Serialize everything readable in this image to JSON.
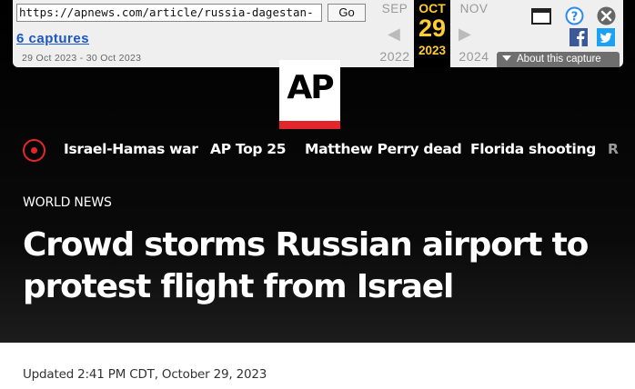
{
  "wayback": {
    "url": "https://apnews.com/article/russia-dagestan-",
    "go_label": "Go",
    "captures": "6 captures",
    "range": "29 Oct 2023 - 30 Oct 2023",
    "prev": {
      "month": "SEP",
      "year": "2022"
    },
    "current": {
      "month": "OCT",
      "day": "29",
      "year": "2023"
    },
    "next": {
      "month": "NOV",
      "year": "2024"
    },
    "about": "About this capture",
    "icons": [
      "window-icon",
      "help-icon",
      "close-icon",
      "facebook-icon",
      "twitter-icon"
    ]
  },
  "logo": {
    "text": "AP"
  },
  "nav": {
    "items": [
      "Israel-Hamas war",
      "AP Top 25",
      "Matthew Perry dead",
      "Florida shooting",
      "R"
    ]
  },
  "article": {
    "kicker": "WORLD NEWS",
    "headline": "Crowd storms Russian airport to protest flight from Israel",
    "updated": "Updated 2:41 PM CDT, October 29, 2023"
  },
  "colors": {
    "accent": "#e3262b",
    "wayback_highlight": "#ffcc33",
    "link": "#1a56c4"
  }
}
